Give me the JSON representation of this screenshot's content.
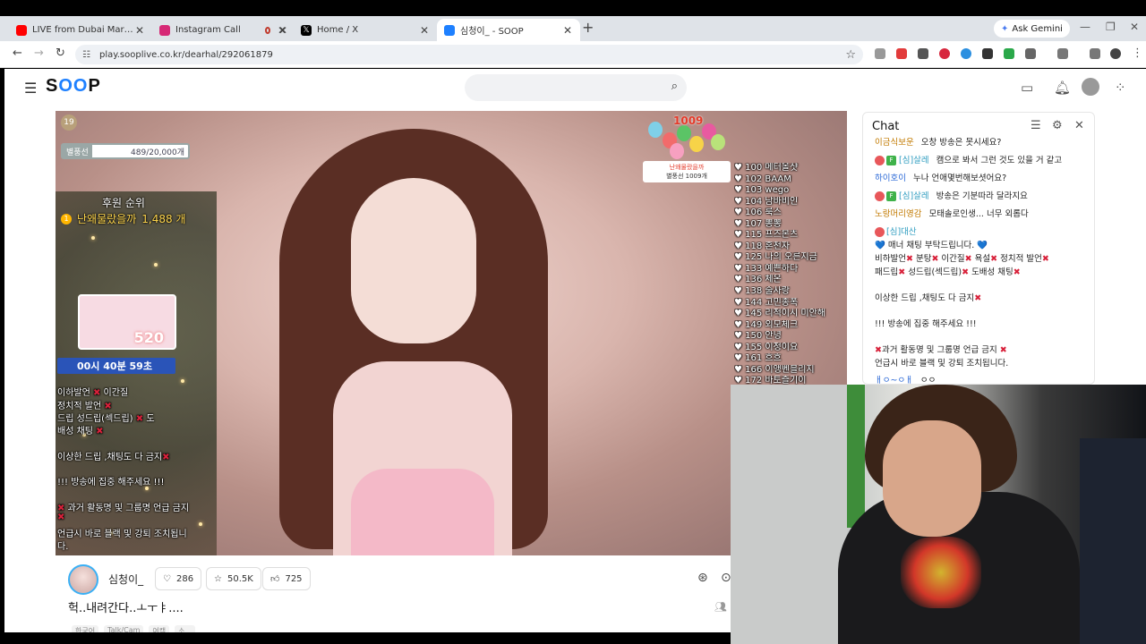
{
  "browser": {
    "tabs": [
      {
        "title": "LIVE from Dubai Marina – Tensi",
        "favicon_color": "#ff0000",
        "active": false
      },
      {
        "title": "Instagram Call",
        "favicon_color": "#d62976",
        "active": false
      },
      {
        "title": "",
        "favicon_color": "#c0392b",
        "active": false
      },
      {
        "title": "Home / X",
        "favicon_color": "#000000",
        "active": false
      },
      {
        "title": "심청이_ - SOOP",
        "favicon_color": "#1e80ff",
        "active": true
      }
    ],
    "new_tab": "+",
    "gemini": "Ask Gemini",
    "url": "play.sooplive.co.kr/dearhal/292061879"
  },
  "site": {
    "logo": "SOOP"
  },
  "video": {
    "age_badge": "19",
    "balloon_label": "별풍선",
    "balloon_progress": "489/20,000개",
    "support_title": "후원 순위",
    "support_rank": "1",
    "support_name": "난왜물랐을까",
    "support_amount": "1,488 개",
    "promo_num": "520",
    "timer": "00시 40분 59초",
    "goal_count": "1009",
    "goal_card_title": "난왜물랐을까",
    "goal_card_sub": "별풍선 1009개",
    "overlay_lines": [
      "이하발언 ✖ 이간질",
      "정치적 발언 ✖",
      "드립 성드립(섹드립) ✖ 도",
      "배성 채팅 ✖",
      "이상한 드립 ,채팅도 다 금지✖",
      "!!! 방송에 집중 해주세요 !!!",
      "✖ 과거 활동명 및 그룹명 언급 금지",
      "✖",
      "언급시 바로 블랙 및 강퇴 조치됩니",
      "다."
    ],
    "rank_list": [
      "♥ 100 메터올샷",
      "♥ 102 BAAM",
      "♥ 103 wego",
      "♥ 104 남바비인",
      "♥ 106 룩스",
      "♥ 107 뽕뽕",
      "♥ 115 프즈몬츠",
      "♥ 118 혼천자",
      "♥ 125 나의 오른지금",
      "♥ 133 예쁜하다",
      "♥ 136 체온",
      "♥ 138 술사랑",
      "♥ 144 고민종폭",
      "♥ 145 리적이시 미안해",
      "♥ 149 외모체크",
      "♥ 150 안녕",
      "♥ 155 이정이요",
      "♥ 161 흐흐",
      "♥ 166 이앵벤블리지",
      "♥ 172 바토즐기이"
    ]
  },
  "channel": {
    "name": "심청이_",
    "stat1": "286",
    "stat2": "50.5K",
    "stat3": "725",
    "stream_title": "헉..내려간다..ㅗㅜㅑ....",
    "tags": [
      "한국어",
      "Talk/Cam",
      "여캠",
      "소..."
    ]
  },
  "chat": {
    "title": "Chat",
    "messages": [
      {
        "user": "이금식보운",
        "text": "오창 방송은 못시세요?",
        "ucls": "un-gold",
        "badge": ""
      },
      {
        "user": "[심]살레",
        "text": "캠으로 봐서 그런 것도 있을 거 같고",
        "ucls": "un-teal",
        "badge": "F"
      },
      {
        "user": "하이호이",
        "text": "누나 언애몇번해보셧어요?",
        "ucls": "un-blue",
        "badge": ""
      },
      {
        "user": "[심]살레",
        "text": "방송은 기분따라 달라지요",
        "ucls": "un-teal",
        "badge": "F"
      },
      {
        "user": "노랑머리영감",
        "text": "모태솔로인생... 너무 외롭다",
        "ucls": "un-gold",
        "badge": ""
      },
      {
        "user": "[심]대산",
        "text": "",
        "ucls": "un-teal",
        "badge": ""
      },
      {
        "user": "",
        "text": "💙 매너 채팅 부탁드립니다. 💙",
        "ucls": "",
        "badge": ""
      },
      {
        "user": "",
        "text": "비하발언✖ 분탕✖ 이간질✖ 욕설✖ 정치적 발언✖",
        "ucls": "",
        "badge": ""
      },
      {
        "user": "",
        "text": "패드립✖ 성드립(섹드립)✖ 도배성 채팅✖",
        "ucls": "",
        "badge": ""
      },
      {
        "user": "",
        "text": "이상한 드립 ,채팅도 다 금지✖",
        "ucls": "",
        "badge": ""
      },
      {
        "user": "",
        "text": "!!! 방송에 집중 해주세요 !!!",
        "ucls": "",
        "badge": ""
      },
      {
        "user": "",
        "text": "✖과거 활동명 및 그룹명 언급 금지 ✖",
        "ucls": "",
        "badge": ""
      },
      {
        "user": "",
        "text": "언급시 바로 블랙 및 강퇴 조치됩니다.",
        "ucls": "",
        "badge": ""
      },
      {
        "user": "ㅐㅇ~ㅇㅐ",
        "text": "ㅇㅇ",
        "ucls": "un-blue",
        "badge": ""
      }
    ]
  },
  "colors": {
    "accent": "#1e80ff",
    "timer_bg": "#2a54b8",
    "goal_red": "#e43a2a",
    "ban_red": "#d8213a"
  }
}
